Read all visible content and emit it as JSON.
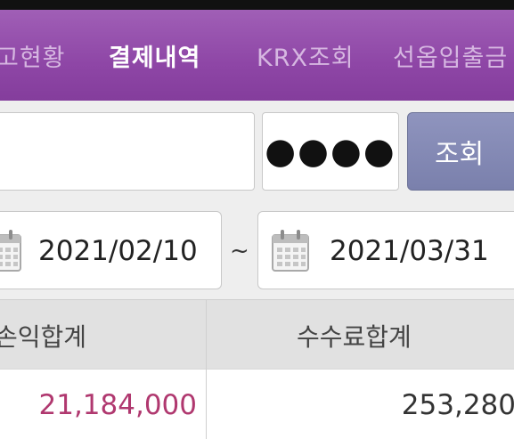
{
  "tabs": [
    {
      "label": "고현황",
      "active": false
    },
    {
      "label": "결제내역",
      "active": true
    },
    {
      "label": "KRX조회",
      "active": false
    },
    {
      "label": "선옵입출금",
      "active": false
    }
  ],
  "form": {
    "id_value": "",
    "password_display": "●●●●",
    "search_label": "조회"
  },
  "date_range": {
    "from": "2021/02/10",
    "separator": "~",
    "to": "2021/03/31"
  },
  "table": {
    "headers": [
      "손익합계",
      "수수료합계"
    ],
    "rows": [
      {
        "profit_total": "21,184,000",
        "fee_total": "253,280"
      }
    ]
  },
  "colors": {
    "tab_bar": "#8e46a6",
    "active_tab": "#ffffff",
    "inactive_tab": "#d6b7e1",
    "search_button": "#8289b5",
    "profit_value": "#b0386f"
  },
  "icons": [
    "calendar-icon"
  ]
}
